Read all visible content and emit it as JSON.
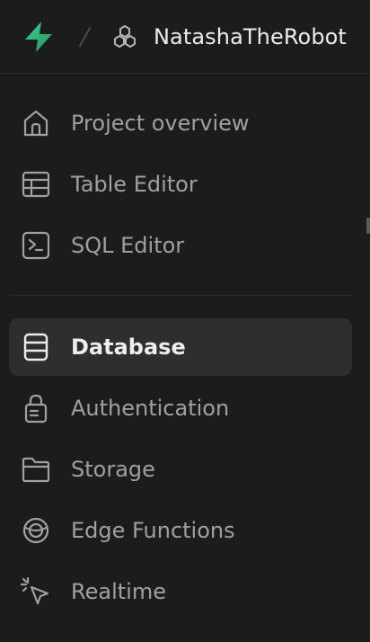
{
  "header": {
    "logo_icon": "supabase-bolt-icon",
    "project_icon": "cubes-icon",
    "project_name": "NatashaTheRobot"
  },
  "nav": {
    "items": [
      {
        "label": "Project overview",
        "icon": "home-icon",
        "active": false
      },
      {
        "label": "Table Editor",
        "icon": "table-icon",
        "active": false
      },
      {
        "label": "SQL Editor",
        "icon": "terminal-icon",
        "active": false
      },
      {
        "label": "Database",
        "icon": "database-icon",
        "active": true
      },
      {
        "label": "Authentication",
        "icon": "lock-icon",
        "active": false
      },
      {
        "label": "Storage",
        "icon": "folder-icon",
        "active": false
      },
      {
        "label": "Edge Functions",
        "icon": "globe-icon",
        "active": false
      },
      {
        "label": "Realtime",
        "icon": "cursor-click-icon",
        "active": false
      }
    ]
  },
  "colors": {
    "background": "#1c1c1c",
    "active_item": "#2e2e2e",
    "text_muted": "#a0a0a0",
    "text_active": "#ededed",
    "brand": "#3ecf8e"
  }
}
